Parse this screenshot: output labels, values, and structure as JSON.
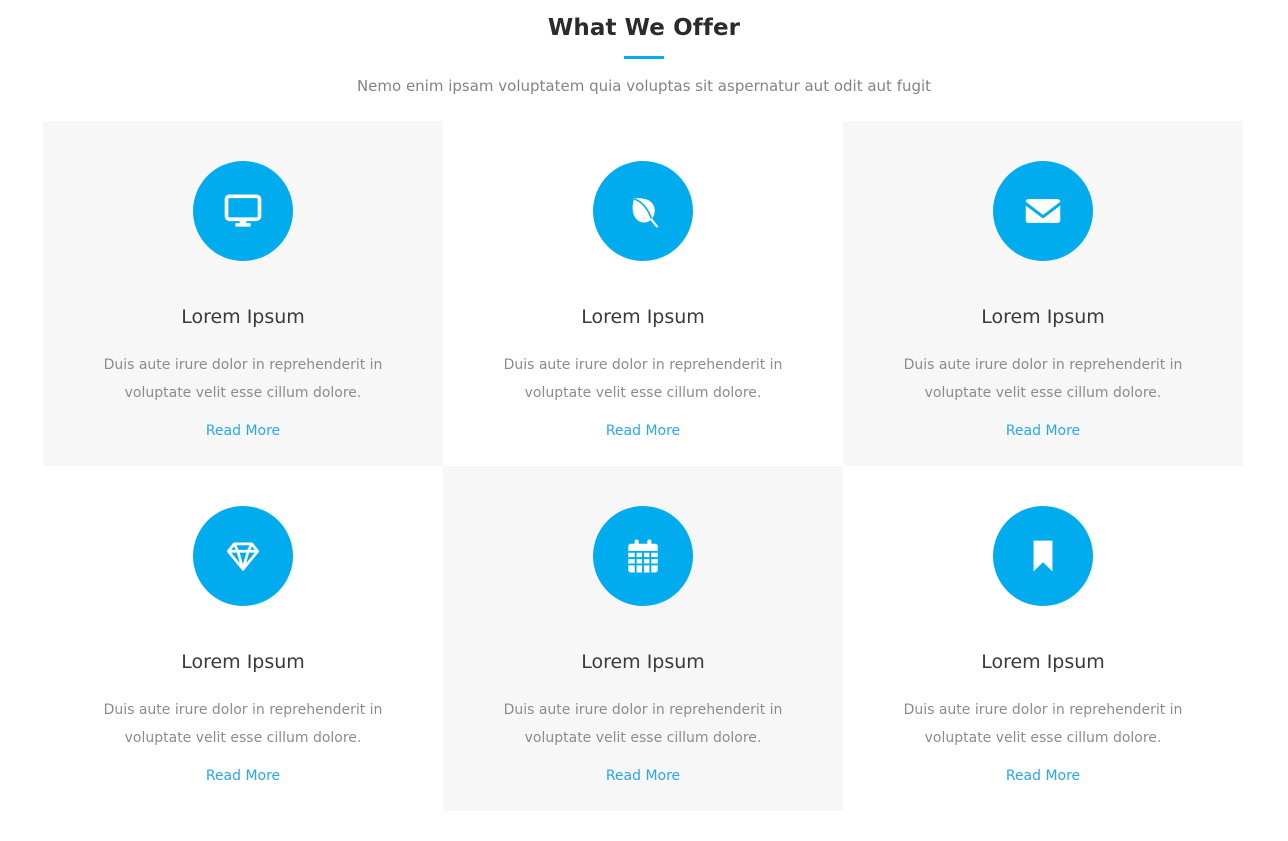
{
  "section": {
    "title": "What We Offer",
    "subtitle": "Nemo enim ipsam voluptatem quia voluptas sit aspernatur aut odit aut fugit",
    "accent_color": "#00aced",
    "title_color": "#2b2b2b",
    "subtitle_color": "#848484"
  },
  "colors": {
    "icon_circle": "#00aced",
    "icon_glyph": "#ffffff",
    "card_shaded_bg": "#f7f7f7",
    "card_plain_bg": "#ffffff",
    "link": "#2aa7e8",
    "page_bg": "#ffffff"
  },
  "cards": [
    {
      "icon": "desktop-monitor-icon",
      "title": "Lorem Ipsum",
      "description": "Duis aute irure dolor in reprehenderit in voluptate velit esse cillum dolore.",
      "link_label": "Read More",
      "shaded": true
    },
    {
      "icon": "leaf-icon",
      "title": "Lorem Ipsum",
      "description": "Duis aute irure dolor in reprehenderit in voluptate velit esse cillum dolore.",
      "link_label": "Read More",
      "shaded": false
    },
    {
      "icon": "envelope-icon",
      "title": "Lorem Ipsum",
      "description": "Duis aute irure dolor in reprehenderit in voluptate velit esse cillum dolore.",
      "link_label": "Read More",
      "shaded": true
    },
    {
      "icon": "diamond-gem-icon",
      "title": "Lorem Ipsum",
      "description": "Duis aute irure dolor in reprehenderit in voluptate velit esse cillum dolore.",
      "link_label": "Read More",
      "shaded": false
    },
    {
      "icon": "calendar-icon",
      "title": "Lorem Ipsum",
      "description": "Duis aute irure dolor in reprehenderit in voluptate velit esse cillum dolore.",
      "link_label": "Read More",
      "shaded": true
    },
    {
      "icon": "bookmark-icon",
      "title": "Lorem Ipsum",
      "description": "Duis aute irure dolor in reprehenderit in voluptate velit esse cillum dolore.",
      "link_label": "Read More",
      "shaded": false
    }
  ]
}
